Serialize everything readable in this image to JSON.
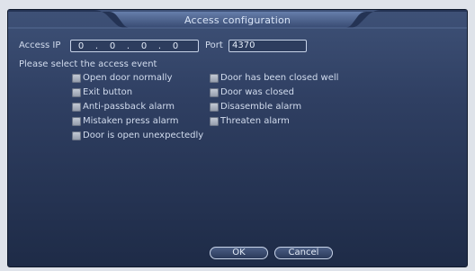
{
  "dialog": {
    "title": "Access configuration"
  },
  "network": {
    "ip_label": "Access IP",
    "ip_octets": [
      "0",
      "0",
      "0",
      "0"
    ],
    "ip_sep": ".",
    "port_label": "Port",
    "port_value": "4370"
  },
  "events": {
    "prompt": "Please select the access event",
    "left": [
      "Open door normally",
      "Exit button",
      "Anti-passback alarm",
      "Mistaken press alarm",
      "Door is open unexpectedly"
    ],
    "right": [
      "Door has been closed well",
      "Door was closed",
      "Disasemble alarm",
      "Threaten alarm"
    ]
  },
  "buttons": {
    "ok": "OK",
    "cancel": "Cancel"
  },
  "colors": {
    "panel_top": "#3e5177",
    "panel_bottom": "#1e2b47",
    "text": "#d2dcee"
  }
}
